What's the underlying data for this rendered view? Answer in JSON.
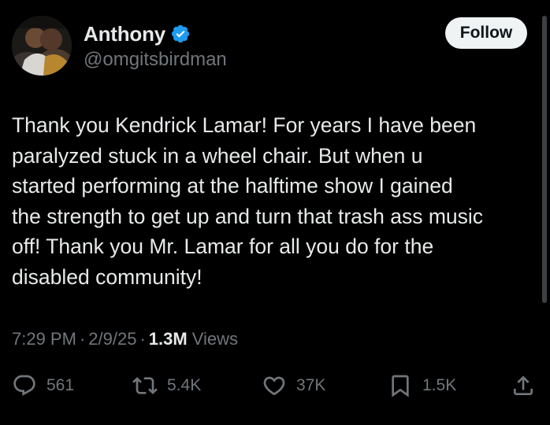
{
  "author": {
    "display_name": "Anthony",
    "handle": "@omgitsbirdman",
    "verified": true
  },
  "follow_label": "Follow",
  "tweet": {
    "text": "Thank you Kendrick Lamar! For years I have been\nparalyzed stuck in a wheel chair. But when u\nstarted performing at the halftime show I gained\nthe strength to get up and turn that trash ass music\noff! Thank you Mr. Lamar for all you do for the\ndisabled community!",
    "time": "7:29 PM",
    "date": "2/9/25",
    "views_count": "1.3M",
    "views_label": "Views",
    "separator": "·"
  },
  "actions": {
    "replies": {
      "icon": "reply-icon",
      "count": "561"
    },
    "reposts": {
      "icon": "repost-icon",
      "count": "5.4K"
    },
    "likes": {
      "icon": "heart-icon",
      "count": "37K"
    },
    "bookmarks": {
      "icon": "bookmark-icon",
      "count": "1.5K"
    },
    "share": {
      "icon": "share-icon"
    }
  },
  "colors": {
    "background": "#000000",
    "text_primary": "#e7e9ea",
    "text_secondary": "#71767b",
    "verified_blue": "#1d9bf0",
    "follow_button_bg": "#eff3f4",
    "follow_button_text": "#0f1419"
  }
}
